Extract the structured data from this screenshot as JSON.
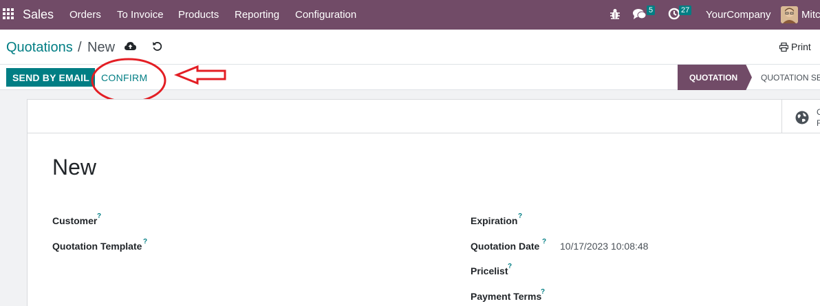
{
  "navbar": {
    "app_name": "Sales",
    "menu": [
      "Orders",
      "To Invoice",
      "Products",
      "Reporting",
      "Configuration"
    ],
    "messages_count": "5",
    "activities_count": "27",
    "company": "YourCompany",
    "user_name_visible": "Mitc"
  },
  "breadcrumb": {
    "parent": "Quotations",
    "separator": "/",
    "current": "New"
  },
  "header": {
    "print_label": "Print"
  },
  "actions": {
    "send_by_email": "SEND BY EMAIL",
    "confirm": "CONFIRM"
  },
  "statusbar": {
    "active": "QUOTATION",
    "next": "QUOTATION SE"
  },
  "smart_button": {
    "line1": "C",
    "line2": "F"
  },
  "form": {
    "title": "New",
    "left_fields": [
      {
        "label": "Customer",
        "help": "?"
      },
      {
        "label": "Quotation Template",
        "help": "?"
      }
    ],
    "right_fields": [
      {
        "label": "Expiration",
        "help": "?",
        "value": ""
      },
      {
        "label": "Quotation Date",
        "help": "?",
        "value": "10/17/2023 10:08:48"
      },
      {
        "label": "Pricelist",
        "help": "?",
        "value": ""
      },
      {
        "label": "Payment Terms",
        "help": "?",
        "value": ""
      }
    ]
  },
  "colors": {
    "brand": "#714b67",
    "accent": "#017e84",
    "annotation": "#e31e24"
  },
  "icons": [
    "apps-grid-icon",
    "bug-icon",
    "chat-icon",
    "clock-icon",
    "cloud-upload-icon",
    "undo-icon",
    "printer-icon",
    "globe-icon",
    "arrow-left-annotation"
  ]
}
